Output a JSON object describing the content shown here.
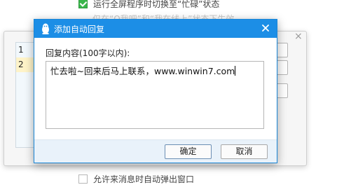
{
  "background": {
    "top_option": {
      "label": "运行全屏程序时切换至“忙碌”状态",
      "checked": true
    },
    "faded_hint": "仅在“Q我吧”和“我在线上”状态下生效",
    "bottom_option": {
      "label": "允许来消息时自动弹出窗口",
      "checked": false
    }
  },
  "middle_dialog": {
    "close_glyph": "×",
    "list_items": [
      "1",
      "2"
    ]
  },
  "dialog": {
    "title": "添加自动回复",
    "close_glyph": "×",
    "content_label": "回复内容(100字以内):",
    "reply_text": "忙去啦~回来后马上联系，www.winwin7.com",
    "ok_label": "确定",
    "cancel_label": "取消"
  },
  "colors": {
    "titlebar": "#1c8ee6",
    "footer": "#e9f2fa",
    "checkbox_checked": "#39b54a"
  }
}
